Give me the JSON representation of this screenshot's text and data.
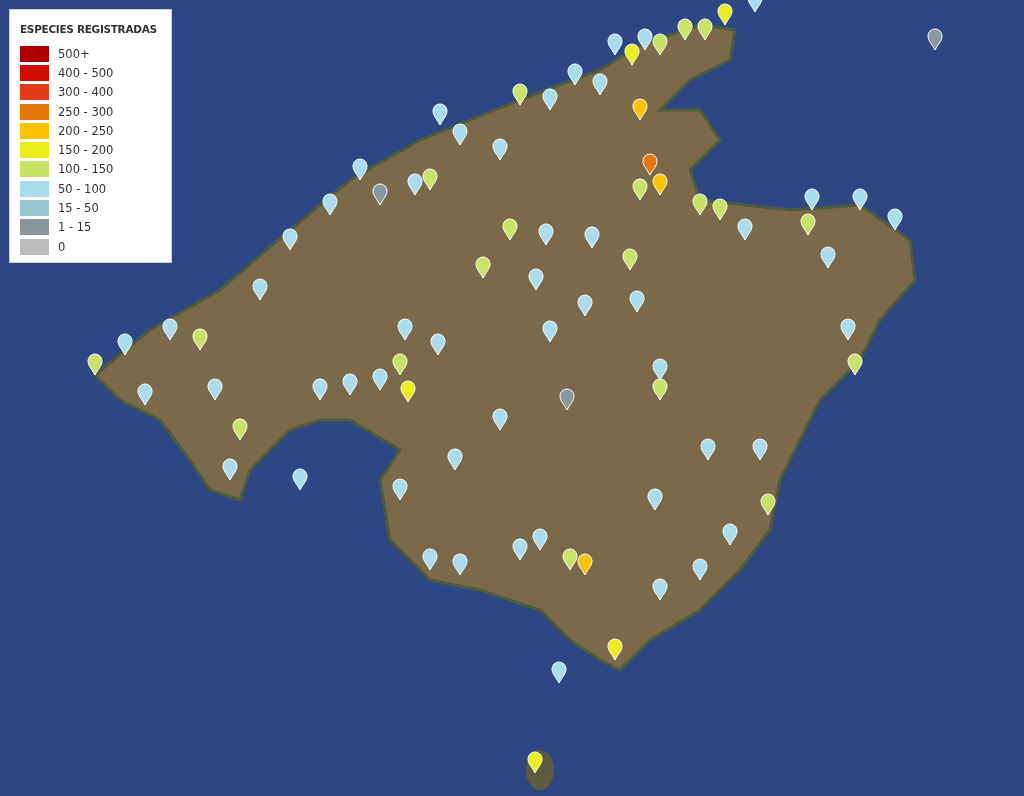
{
  "legend": {
    "title": "ESPECIES REGISTRADAS",
    "items": [
      {
        "label": "500+",
        "color": "#ad0000"
      },
      {
        "label": "400 - 500",
        "color": "#d20d00"
      },
      {
        "label": "300 - 400",
        "color": "#e33a16"
      },
      {
        "label": "250 - 300",
        "color": "#e6770a"
      },
      {
        "label": "200 - 250",
        "color": "#fcc400"
      },
      {
        "label": "150 - 200",
        "color": "#ebee1c"
      },
      {
        "label": "100 - 150",
        "color": "#c9e366"
      },
      {
        "label": "50 - 100",
        "color": "#a9dded"
      },
      {
        "label": "15 - 50",
        "color": "#98c4ce"
      },
      {
        "label": "1 - 15",
        "color": "#8a979c"
      },
      {
        "label": "0",
        "color": "#bdbdbd"
      }
    ]
  }
}
